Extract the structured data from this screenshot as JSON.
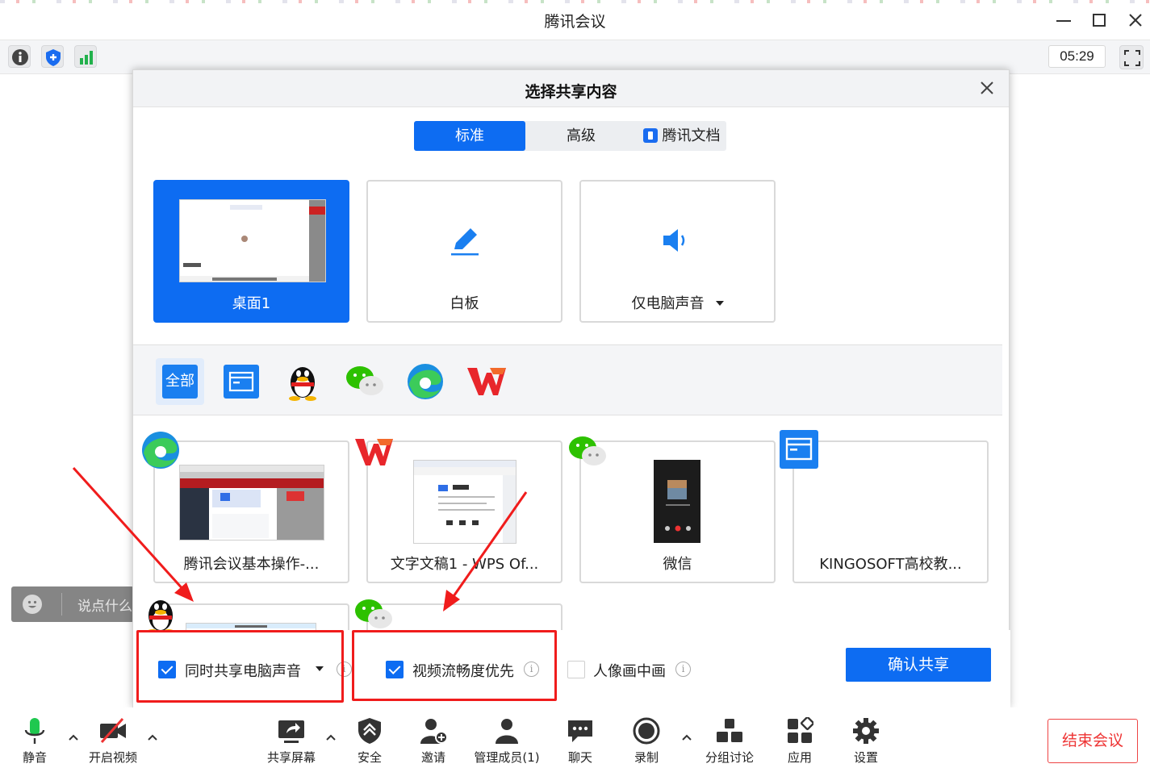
{
  "window": {
    "title": "腾讯会议",
    "timer": "05:29"
  },
  "chat": {
    "placeholder": "说点什么..."
  },
  "dialog": {
    "title": "选择共享内容",
    "tabs": [
      {
        "label": "标准",
        "active": true
      },
      {
        "label": "高级",
        "active": false
      },
      {
        "label": "腾讯文档",
        "active": false
      }
    ],
    "share_cards": [
      {
        "label": "桌面1",
        "selected": true
      },
      {
        "label": "白板",
        "selected": false
      },
      {
        "label": "仅电脑声音",
        "selected": false
      }
    ],
    "app_filters": [
      {
        "label": "全部",
        "icon": "all-chip",
        "active": true
      },
      {
        "icon": "window-icon",
        "active": false
      },
      {
        "icon": "qq-icon",
        "active": false
      },
      {
        "icon": "wechat-icon",
        "active": false
      },
      {
        "icon": "edge-icon",
        "active": false
      },
      {
        "icon": "wps-icon",
        "active": false
      }
    ],
    "windows": [
      {
        "label": "腾讯会议基本操作-...",
        "icon": "edge-icon"
      },
      {
        "label": "文字文稿1 - WPS Of...",
        "icon": "wps-icon"
      },
      {
        "label": "微信",
        "icon": "wechat-icon"
      },
      {
        "label": "KINGOSOFT高校教...",
        "icon": "window-icon"
      },
      {
        "label": "",
        "icon": "qq-icon"
      },
      {
        "label": "",
        "icon": "wechat-icon"
      }
    ],
    "options": {
      "share_audio": {
        "label": "同时共享电脑声音",
        "checked": true
      },
      "video_smooth": {
        "label": "视频流畅度优先",
        "checked": true
      },
      "pip": {
        "label": "人像画中画",
        "checked": false
      }
    },
    "confirm_label": "确认共享"
  },
  "bottom_bar": {
    "items": [
      {
        "label": "静音",
        "icon": "microphone-icon"
      },
      {
        "label": "开启视频",
        "icon": "video-off-icon"
      },
      {
        "label": "共享屏幕",
        "icon": "share-screen-icon"
      },
      {
        "label": "安全",
        "icon": "shield-icon"
      },
      {
        "label": "邀请",
        "icon": "invite-icon"
      },
      {
        "label": "管理成员(1)",
        "icon": "members-icon"
      },
      {
        "label": "聊天",
        "icon": "chat-icon"
      },
      {
        "label": "录制",
        "icon": "record-icon"
      },
      {
        "label": "分组讨论",
        "icon": "breakout-icon"
      },
      {
        "label": "应用",
        "icon": "apps-icon"
      },
      {
        "label": "设置",
        "icon": "gear-icon"
      }
    ],
    "end_label": "结束会议"
  },
  "colors": {
    "accent": "#0d6cf2",
    "annotation_red": "#f01c1c",
    "end_red": "#e33333"
  }
}
